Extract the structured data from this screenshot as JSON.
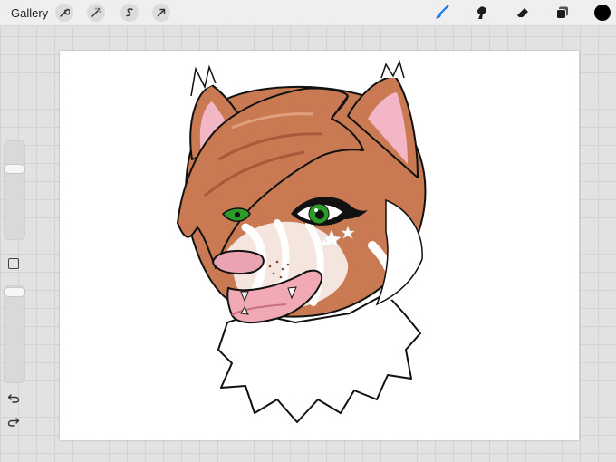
{
  "topbar": {
    "gallery_label": "Gallery",
    "left_tools": [
      "wrench-icon",
      "magic-wand-icon",
      "selection-s-icon",
      "transform-arrow-icon"
    ],
    "right_tools": [
      "brush-icon",
      "smudge-icon",
      "eraser-icon",
      "layers-icon"
    ],
    "active_tool": "brush",
    "current_color": "#000000",
    "accent": "#1a7ae8"
  },
  "sidebar": {
    "brush_size_level": 0.73,
    "opacity_level": 0.97,
    "buttons": [
      "modify-square-icon",
      "undo-icon",
      "redo-icon"
    ]
  },
  "canvas": {
    "background": "#ffffff",
    "artwork": "fox-headshot-artwork",
    "palette": {
      "fur": "#c97a52",
      "fur_dark": "#a9593a",
      "ear_pink": "#f3b6c4",
      "nose_pink": "#eaa3b2",
      "eye_green": "#2e9a2a",
      "outline": "#111111"
    }
  }
}
